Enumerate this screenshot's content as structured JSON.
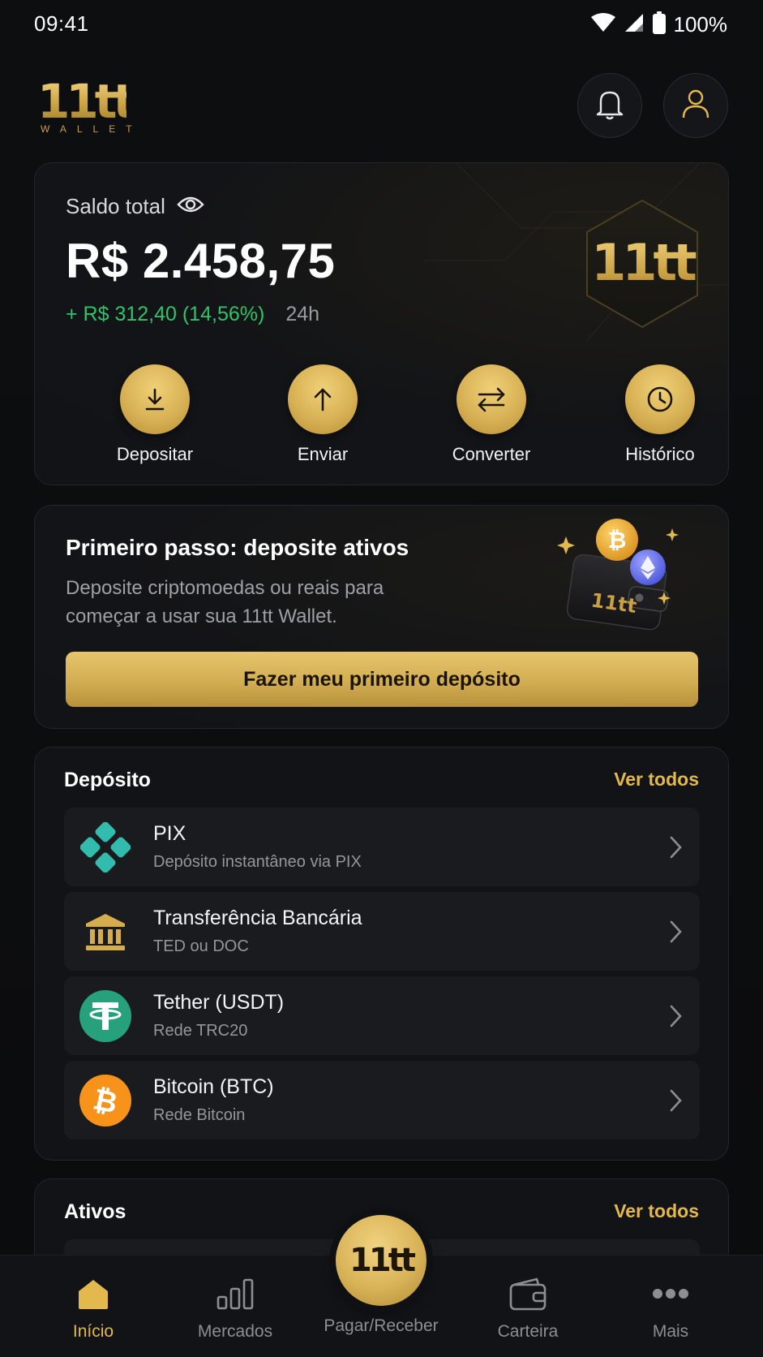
{
  "status_bar": {
    "time": "09:41",
    "battery": "100%"
  },
  "header": {
    "logo_main": "11tt",
    "logo_sub": "WALLET",
    "notifications_icon": "bell-icon",
    "profile_icon": "user-icon"
  },
  "balance": {
    "label": "Saldo total",
    "value": "R$ 2.458,75",
    "change": "+ R$ 312,40 (14,56%)",
    "period": "24h",
    "badge_text": "11tt",
    "change_color": "#2fc46a"
  },
  "actions": [
    {
      "label": "Depositar",
      "icon": "download-icon"
    },
    {
      "label": "Enviar",
      "icon": "arrow-up-icon"
    },
    {
      "label": "Converter",
      "icon": "swap-icon"
    },
    {
      "label": "Histórico",
      "icon": "clock-icon"
    }
  ],
  "promo": {
    "title": "Primeiro passo: deposite ativos",
    "text": "Deposite criptomoedas ou reais para começar a usar sua 11tt Wallet.",
    "button": "Fazer meu primeiro depósito",
    "wallet_text": "11tt"
  },
  "deposit": {
    "title": "Depósito",
    "link": "Ver todos",
    "items": [
      {
        "title": "PIX",
        "subtitle": "Depósito instantâneo via PIX",
        "icon": "pix-icon"
      },
      {
        "title": "Transferência Bancária",
        "subtitle": "TED ou DOC",
        "icon": "bank-icon"
      },
      {
        "title": "Tether (USDT)",
        "subtitle": "Rede TRC20",
        "icon": "tether-icon"
      },
      {
        "title": "Bitcoin (BTC)",
        "subtitle": "Rede Bitcoin",
        "icon": "bitcoin-icon"
      }
    ]
  },
  "assets": {
    "title": "Ativos",
    "link": "Ver todos"
  },
  "nav": {
    "items": [
      {
        "label": "Início",
        "icon": "home-icon",
        "active": true
      },
      {
        "label": "Mercados",
        "icon": "bar-chart-icon",
        "active": false
      },
      {
        "label": "Pagar/Receber",
        "icon": "11tt-logo",
        "active": false
      },
      {
        "label": "Carteira",
        "icon": "wallet-icon",
        "active": false
      },
      {
        "label": "Mais",
        "icon": "more-icon",
        "active": false
      }
    ],
    "fab_text": "11tt"
  },
  "colors": {
    "accent_gold": "#e3b94d",
    "background": "#0b0c0e",
    "card": "#121317"
  }
}
